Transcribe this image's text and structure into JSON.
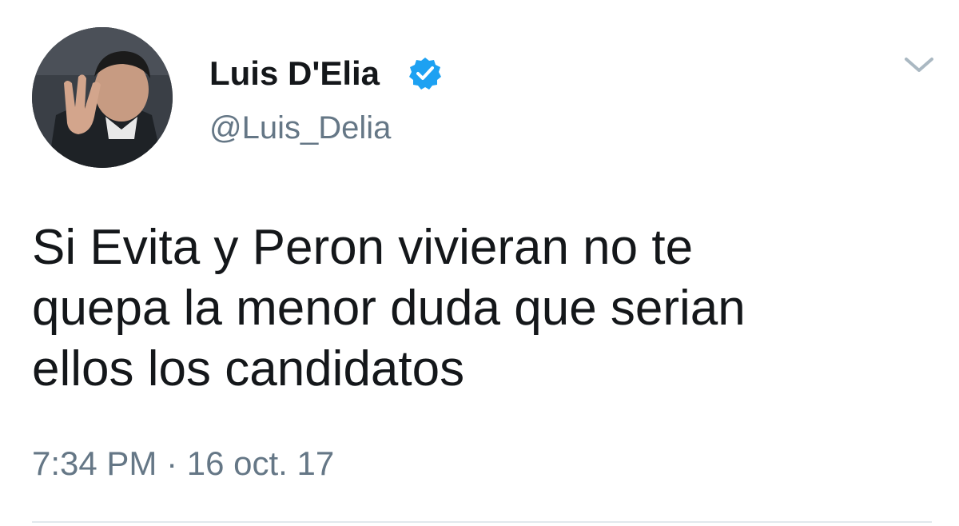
{
  "tweet": {
    "author": {
      "display_name": "Luis D'Elia",
      "handle": "@Luis_Delia",
      "verified": true,
      "avatar_icon": "profile-photo"
    },
    "text_lines": [
      "Si Evita y Peron vivieran no te",
      "quepa la menor duda que serian",
      "ellos los candidatos"
    ],
    "timestamp": {
      "time": "7:34 PM",
      "separator": "·",
      "date": "16 oct. 17"
    },
    "menu_icon": "chevron-down-icon"
  },
  "colors": {
    "text_primary": "#14171a",
    "text_secondary": "#657786",
    "verified_blue": "#1da1f2",
    "divider": "#e1e8ed"
  }
}
